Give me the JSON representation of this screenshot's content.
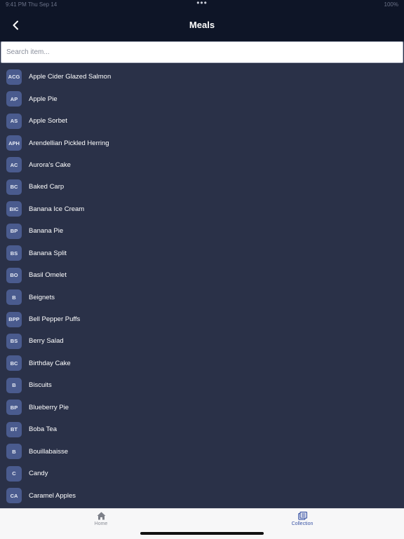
{
  "status": {
    "left": "9:41 PM   Thu Sep 14",
    "dots": "•••",
    "right": "100%"
  },
  "header": {
    "title": "Meals",
    "back_icon": "chevron-left-icon"
  },
  "search": {
    "placeholder": "Search item...",
    "value": ""
  },
  "meals": [
    {
      "initials": "ACG",
      "name": "Apple Cider Glazed Salmon"
    },
    {
      "initials": "AP",
      "name": "Apple Pie"
    },
    {
      "initials": "AS",
      "name": "Apple Sorbet"
    },
    {
      "initials": "APH",
      "name": "Arendellian Pickled Herring"
    },
    {
      "initials": "AC",
      "name": "Aurora's Cake"
    },
    {
      "initials": "BC",
      "name": "Baked Carp"
    },
    {
      "initials": "BIC",
      "name": "Banana Ice Cream"
    },
    {
      "initials": "BP",
      "name": "Banana Pie"
    },
    {
      "initials": "BS",
      "name": "Banana Split"
    },
    {
      "initials": "BO",
      "name": "Basil Omelet"
    },
    {
      "initials": "B",
      "name": "Beignets"
    },
    {
      "initials": "BPP",
      "name": "Bell Pepper Puffs"
    },
    {
      "initials": "BS",
      "name": "Berry Salad"
    },
    {
      "initials": "BC",
      "name": "Birthday Cake"
    },
    {
      "initials": "B",
      "name": "Biscuits"
    },
    {
      "initials": "BP",
      "name": "Blueberry Pie"
    },
    {
      "initials": "BT",
      "name": "Boba Tea"
    },
    {
      "initials": "B",
      "name": "Bouillabaisse"
    },
    {
      "initials": "C",
      "name": "Candy"
    },
    {
      "initials": "CA",
      "name": "Caramel Apples"
    }
  ],
  "tabs": {
    "home": {
      "label": "Home",
      "icon": "home-icon"
    },
    "collection": {
      "label": "Collection",
      "icon": "collection-icon",
      "active": true
    }
  },
  "colors": {
    "background": "#2a3148",
    "header": "#0e1527",
    "avatar": "#4a5b8e",
    "active_tab": "#3c56a6"
  }
}
